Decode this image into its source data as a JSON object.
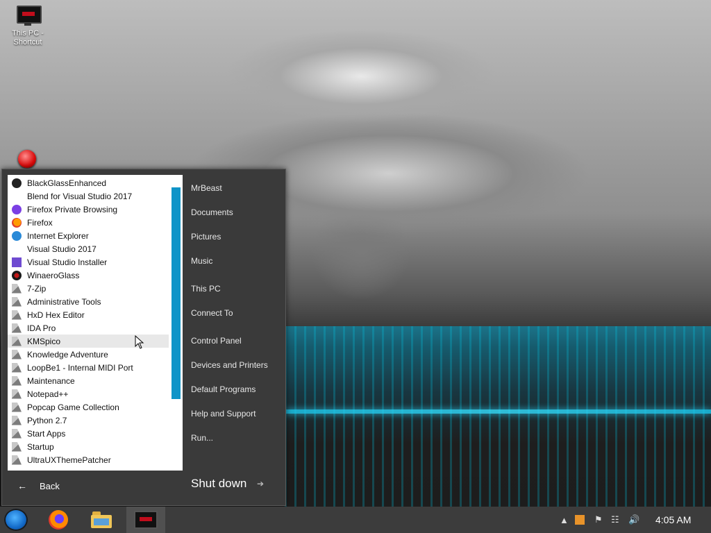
{
  "desktop": {
    "shortcut_label": "This PC - Shortcut"
  },
  "start_menu": {
    "apps": [
      {
        "label": "BlackGlassEnhanced",
        "icon": "black-glass-icon"
      },
      {
        "label": "Blend for Visual Studio 2017",
        "icon": "blank"
      },
      {
        "label": "Firefox Private Browsing",
        "icon": "firefox-private-icon"
      },
      {
        "label": "Firefox",
        "icon": "firefox-icon"
      },
      {
        "label": "Internet Explorer",
        "icon": "internet-explorer-icon"
      },
      {
        "label": "Visual Studio 2017",
        "icon": "blank"
      },
      {
        "label": "Visual Studio Installer",
        "icon": "visual-studio-installer-icon"
      },
      {
        "label": "WinaeroGlass",
        "icon": "winaero-glass-icon"
      },
      {
        "label": "7-Zip",
        "icon": "folder-icon"
      },
      {
        "label": "Administrative Tools",
        "icon": "folder-icon"
      },
      {
        "label": "HxD Hex Editor",
        "icon": "folder-icon"
      },
      {
        "label": "IDA Pro",
        "icon": "folder-icon"
      },
      {
        "label": "KMSpico",
        "icon": "folder-icon"
      },
      {
        "label": "Knowledge Adventure",
        "icon": "folder-icon"
      },
      {
        "label": "LoopBe1 - Internal MIDI Port",
        "icon": "folder-icon"
      },
      {
        "label": "Maintenance",
        "icon": "folder-icon"
      },
      {
        "label": "Notepad++",
        "icon": "folder-icon"
      },
      {
        "label": "Popcap Game Collection",
        "icon": "folder-icon"
      },
      {
        "label": "Python 2.7",
        "icon": "folder-icon"
      },
      {
        "label": "Start Apps",
        "icon": "folder-icon"
      },
      {
        "label": "Startup",
        "icon": "folder-icon"
      },
      {
        "label": "UltraUXThemePatcher",
        "icon": "folder-icon"
      }
    ],
    "back_label": "Back",
    "right_items": [
      "MrBeast",
      "Documents",
      "Pictures",
      "Music",
      "This PC",
      "Connect To",
      "Control Panel",
      "Devices and Printers",
      "Default Programs",
      "Help and Support",
      "Run..."
    ],
    "shutdown_label": "Shut down"
  },
  "taskbar": {
    "clock": "4:05 AM"
  }
}
